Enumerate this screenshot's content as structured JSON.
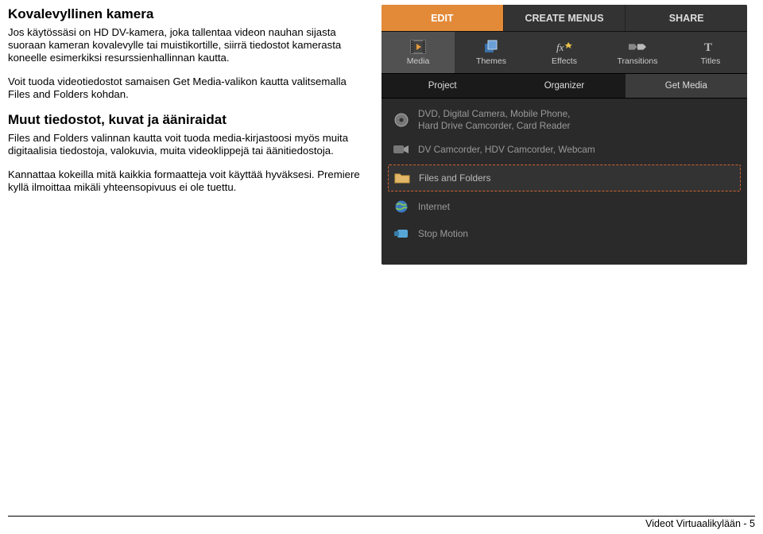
{
  "left": {
    "heading1": "Kovalevyllinen kamera",
    "p1": "Jos käytössäsi on HD DV-kamera, joka tallentaa videon nauhan sijasta suoraan kameran kovalevylle tai muistikortille, siirrä tiedostot kamerasta koneelle esimerkiksi resurssienhallinnan kautta.",
    "p2": "Voit tuoda videotiedostot samaisen Get Media-valikon kautta valitsemalla Files and Folders kohdan.",
    "heading2": "Muut tiedostot, kuvat ja ääniraidat",
    "p3": "Files and Folders valinnan kautta voit tuoda media-kirjastoosi myös muita digitaalisia tiedostoja, valokuvia, muita videoklippejä tai äänitiedostoja.",
    "p4": "Kannattaa kokeilla mitä kaikkia formaatteja voit käyttää hyväksesi. Premiere kyllä ilmoittaa mikäli yhteensopivuus ei ole tuettu."
  },
  "app": {
    "top_tabs": {
      "edit": "EDIT",
      "create": "CREATE MENUS",
      "share": "SHARE"
    },
    "icons": {
      "media": "Media",
      "themes": "Themes",
      "effects": "Effects",
      "transitions": "Transitions",
      "titles": "Titles"
    },
    "sub": {
      "project": "Project",
      "organizer": "Organizer",
      "getmedia": "Get Media"
    },
    "sources": {
      "dvd": "DVD, Digital Camera, Mobile Phone,\nHard Drive Camcorder, Card Reader",
      "dv": "DV Camcorder, HDV Camcorder, Webcam",
      "files": "Files and Folders",
      "internet": "Internet",
      "stop": "Stop Motion"
    }
  },
  "footer": "Videot Virtuaalikylään - 5"
}
